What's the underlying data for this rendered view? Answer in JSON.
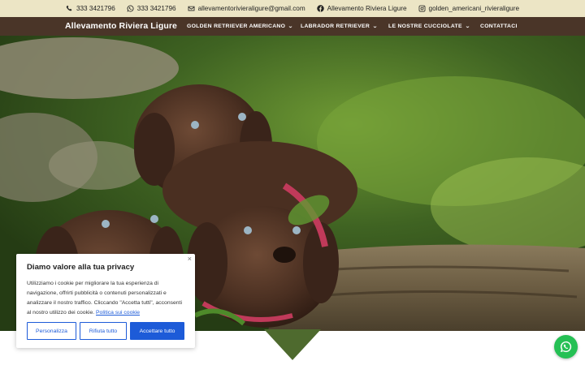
{
  "topbar": {
    "phone1": "333 3421796",
    "whatsapp": "333 3421796",
    "email": "allevamentorivieraligure@gmail.com",
    "facebook": "Allevamento Riviera Ligure",
    "instagram": "golden_americani_rivieraligure"
  },
  "nav": {
    "brand": "Allevamento Riviera Ligure",
    "items": [
      {
        "label": "GOLDEN RETRIEVER AMERICANO",
        "chevron": "chevron-down-icon"
      },
      {
        "label": "LABRADOR RETRIEVER",
        "chevron": "chevron-down-icon"
      },
      {
        "label": "LE NOSTRE CUCCIOLATE",
        "chevron": "chevron-down-icon"
      },
      {
        "label": "CONTATTACI"
      }
    ]
  },
  "cookie": {
    "title": "Diamo valore alla tua privacy",
    "body": "Utilizziamo i cookie per migliorare la tua esperienza di navigazione, offrirti pubblicità o contenuti personalizzati e analizzare il nostro traffico. Cliccando \"Accetta tutti\", acconsenti al nostro utilizzo dei cookie.",
    "policy_link": "Politica sui cookie",
    "customize": "Personalizza",
    "reject": "Rifiuta tutto",
    "accept": "Accettare tutto",
    "close": "×"
  },
  "colors": {
    "topbar_bg": "#ece5c5",
    "nav_bg": "#4a3528",
    "accent_blue": "#1d5bd8",
    "whatsapp_green": "#25c054"
  }
}
